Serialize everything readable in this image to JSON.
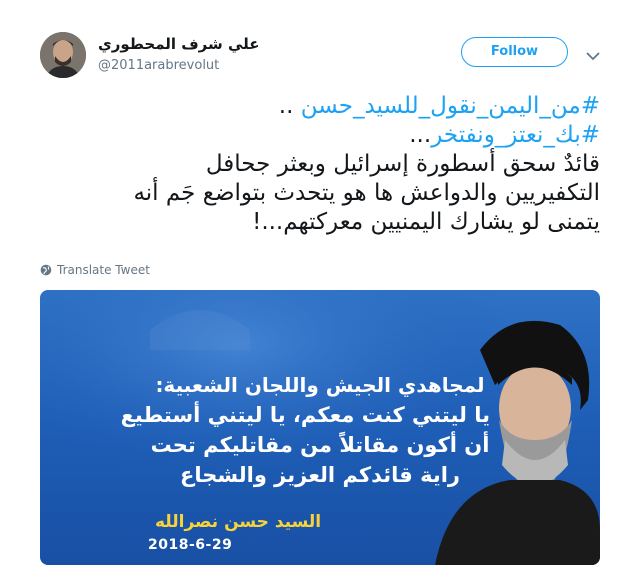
{
  "author": {
    "display_name": "علي شرف المحطوري",
    "handle": "@2011arabrevolut"
  },
  "follow_label": "Follow",
  "tweet": {
    "hashtag1": "#من_اليمن_نقول_للسيد_حسن",
    "hashtag1_suffix": " ..",
    "hashtag2": "#بك_نعتز_ونفتخر",
    "hashtag2_suffix": "...",
    "body_line1": "قائدٌ سحق أسطورة إسرائيل وبعثر جحافل",
    "body_line2": "التكفيريين والدواعش ها هو يتحدث بتواضع جَم أنه",
    "body_line3": "يتمنى لو يشارك اليمنيين معركتهم...!"
  },
  "translate_label": "Translate Tweet",
  "media": {
    "line1": "لمجاهدي الجيش واللجان الشعبية:",
    "line2": "يا ليتني كنت معكم، يا ليتني أستطيع",
    "line3": "أن أكون مقاتلاً من مقاتليكم تحت",
    "line4": "راية قائدكم العزيز والشجاع",
    "signature": "السيد حسن نصرالله",
    "date": "2018-6-29"
  },
  "icons": {
    "more": "chevron-down-icon",
    "translate": "globe-icon"
  },
  "colors": {
    "accent": "#1da1f2",
    "text": "#14171a",
    "muted": "#657786",
    "media_blue": "#1f5fb8",
    "signature_yellow": "#f7d23a"
  }
}
